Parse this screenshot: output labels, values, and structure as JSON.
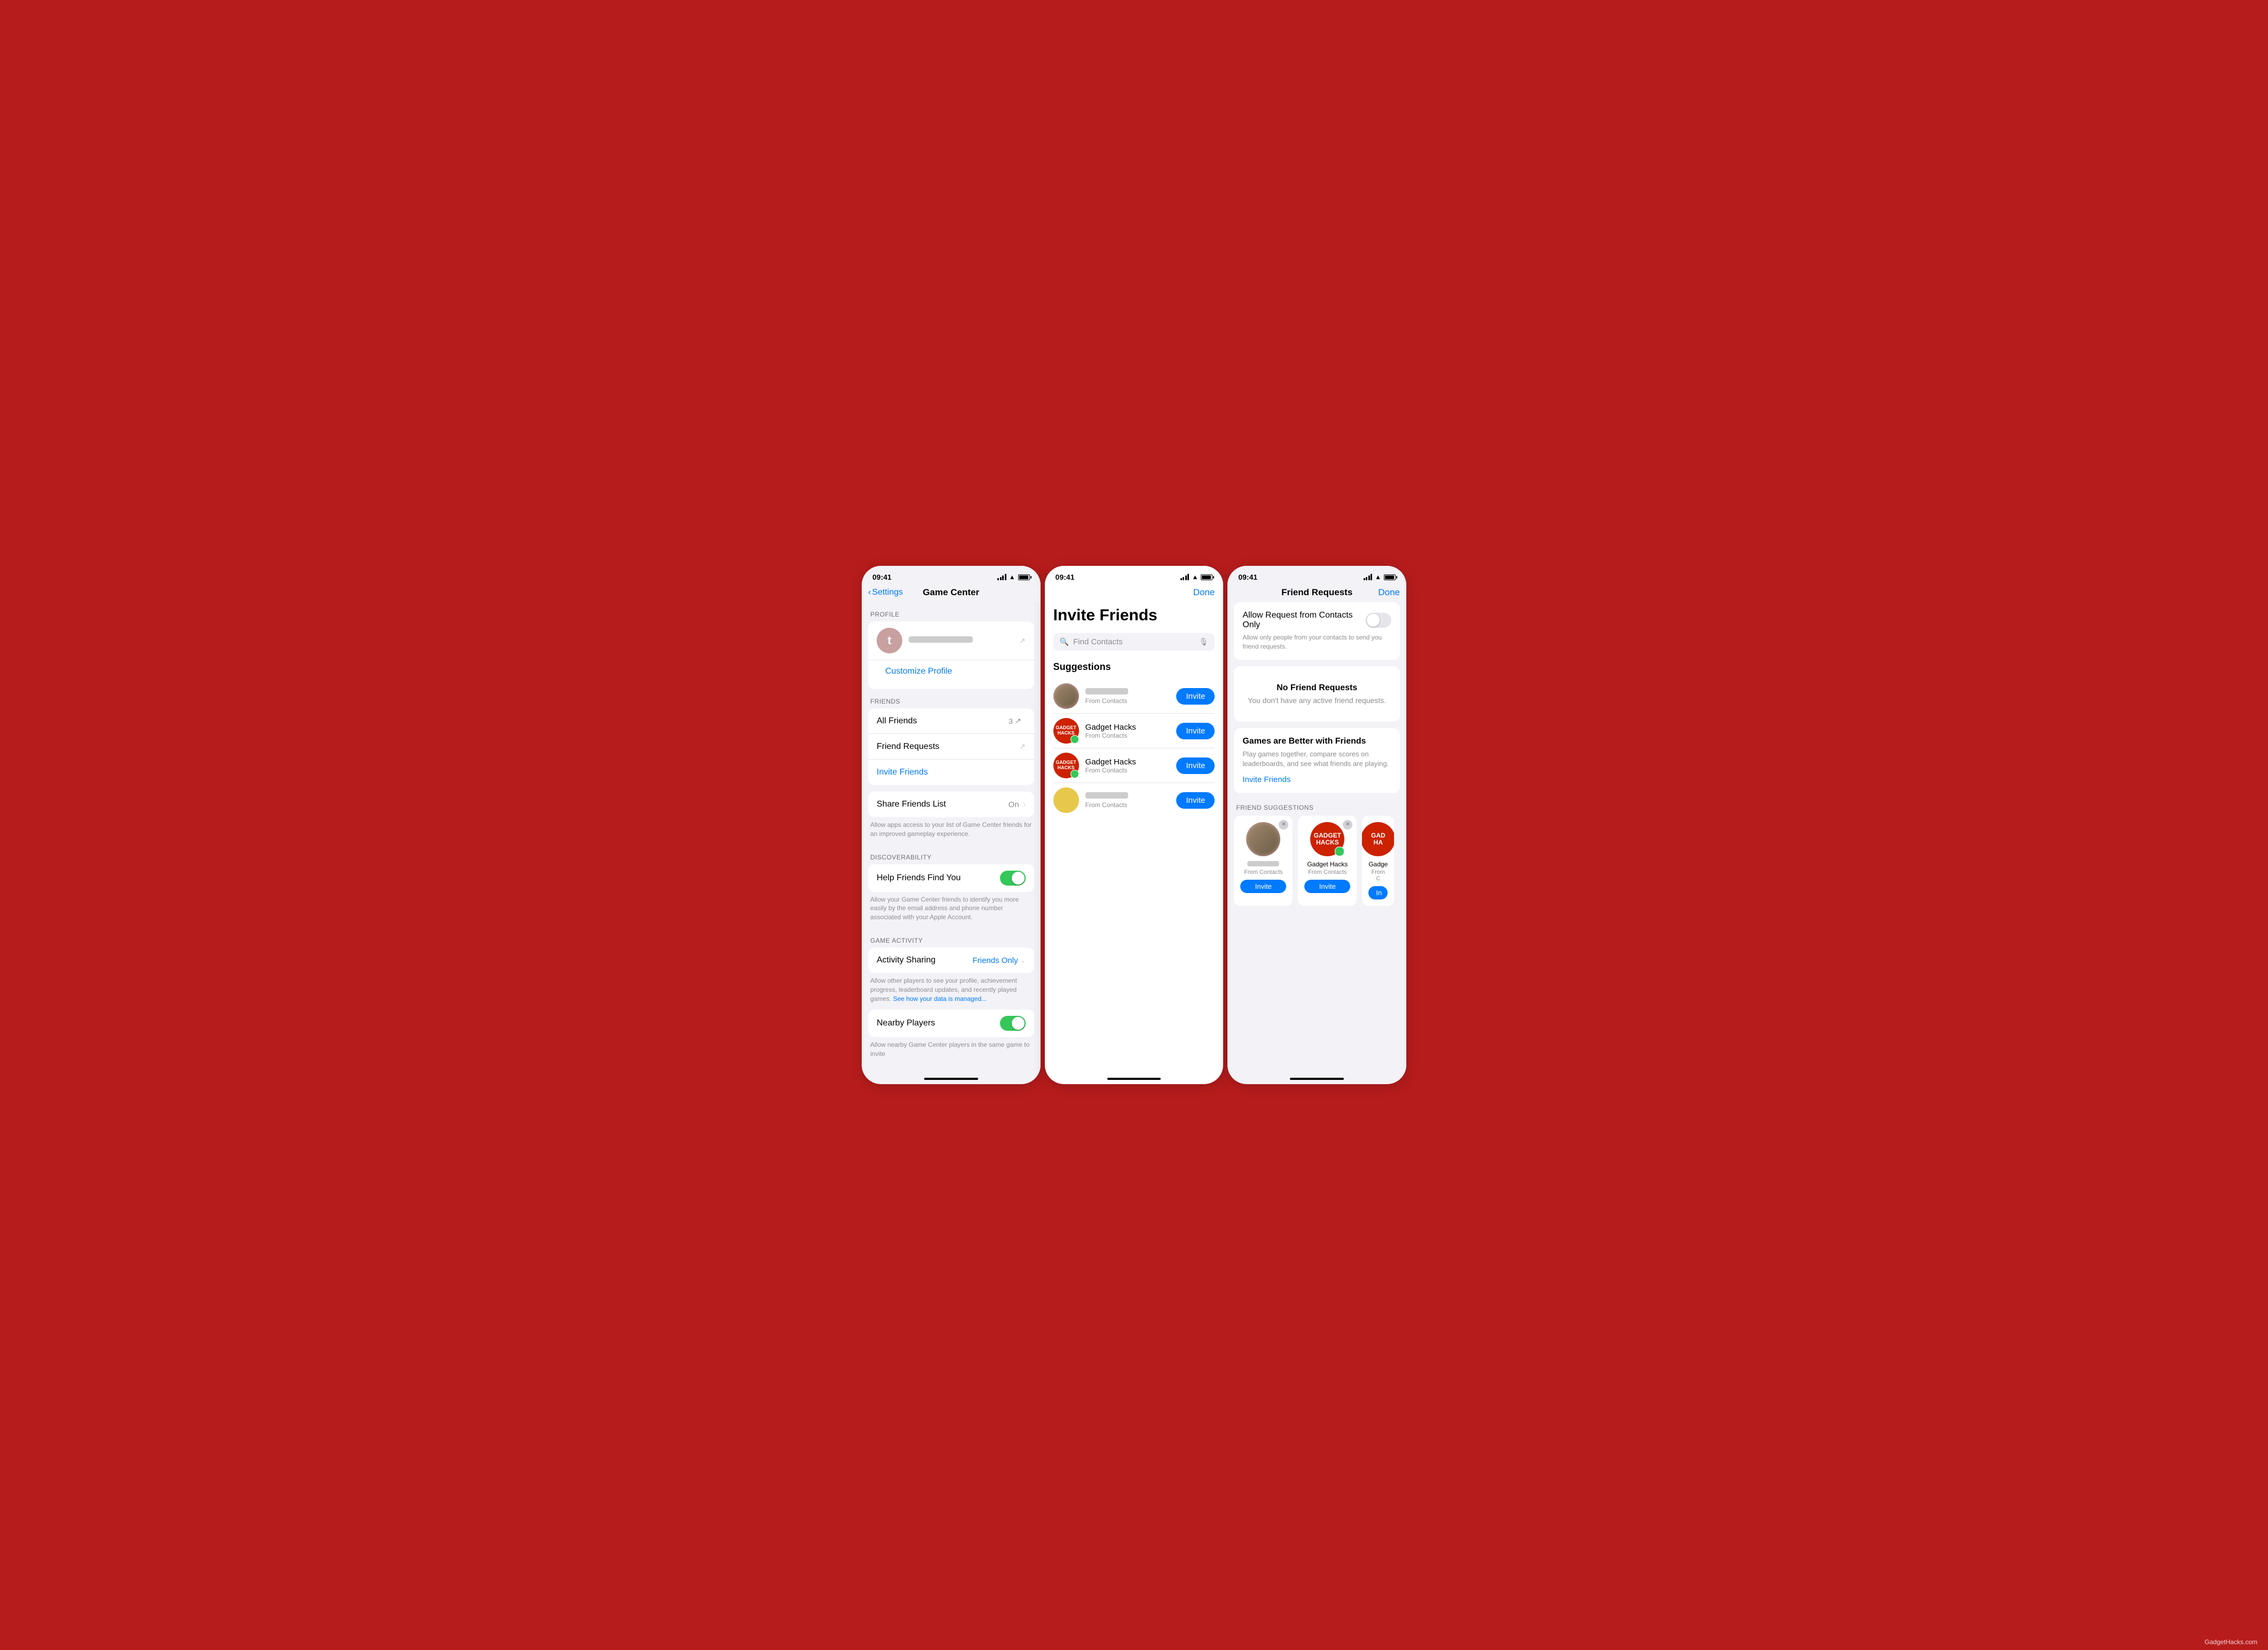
{
  "app": {
    "watermark": "GadgetHacks.com"
  },
  "screen1": {
    "time": "09:41",
    "nav": {
      "back_label": "Settings",
      "title": "Game Center"
    },
    "sections": {
      "profile": {
        "label": "PROFILE",
        "avatar_letter": "t",
        "customize": "Customize Profile"
      },
      "friends": {
        "label": "FRIENDS",
        "all_friends": "All Friends",
        "all_friends_count": "3",
        "friend_requests": "Friend Requests",
        "invite_friends": "Invite Friends"
      },
      "share": {
        "label": "Share Friends List",
        "value": "On"
      },
      "share_helper": "Allow apps access to your list of Game Center friends for an improved gameplay experience.",
      "discoverability": {
        "label": "DISCOVERABILITY",
        "help_find": "Help Friends Find You"
      },
      "help_find_helper": "Allow your Game Center friends to identify you more easily by the email address and phone number associated with your Apple Account.",
      "game_activity": {
        "label": "GAME ACTIVITY",
        "activity_sharing": "Activity Sharing",
        "activity_value": "Friends Only"
      },
      "activity_helper": "Allow other players to see your profile, achievement progress, leaderboard updates, and recently played games.",
      "activity_link": "See how your data is managed...",
      "nearby": {
        "label": "Nearby Players"
      },
      "nearby_helper": "Allow nearby Game Center players in the same game to invite"
    }
  },
  "screen2": {
    "time": "09:41",
    "done": "Done",
    "title": "Invite Friends",
    "search": {
      "placeholder": "Find Contacts"
    },
    "suggestions_title": "Suggestions",
    "suggestions": [
      {
        "id": "s1",
        "name": "",
        "sub": "From Contacts",
        "type": "blur",
        "invite": "Invite"
      },
      {
        "id": "s2",
        "name": "Gadget Hacks",
        "sub": "From Contacts",
        "type": "gadget",
        "invite": "Invite"
      },
      {
        "id": "s3",
        "name": "Gadget Hacks",
        "sub": "From Contacts",
        "type": "gadget",
        "invite": "Invite"
      },
      {
        "id": "s4",
        "name": "",
        "sub": "From Contacts",
        "type": "yellow",
        "invite": "Invite"
      }
    ]
  },
  "screen3": {
    "time": "09:41",
    "title": "Friend Requests",
    "done": "Done",
    "toggle": {
      "label": "Allow Request from Contacts Only",
      "helper": "Allow only people from your contacts to send you friend requests."
    },
    "no_requests": {
      "title": "No Friend Requests",
      "sub": "You don't have any active friend requests."
    },
    "games_better": {
      "title": "Games are Better with Friends",
      "sub": "Play games together, compare scores on leaderboards, and see what friends are playing.",
      "invite_link": "Invite Friends"
    },
    "friend_suggestions_label": "FRIEND SUGGESTIONS",
    "suggestions": [
      {
        "id": "fs1",
        "name": "",
        "sub": "From Contacts",
        "type": "blur",
        "invite": "Invite"
      },
      {
        "id": "fs2",
        "name": "Gadget Hacks",
        "sub": "From Contacts",
        "type": "gadget",
        "invite": "Invite"
      },
      {
        "id": "fs3",
        "name": "Gadge",
        "sub": "From C",
        "type": "gadget_partial",
        "invite": "In"
      }
    ]
  }
}
